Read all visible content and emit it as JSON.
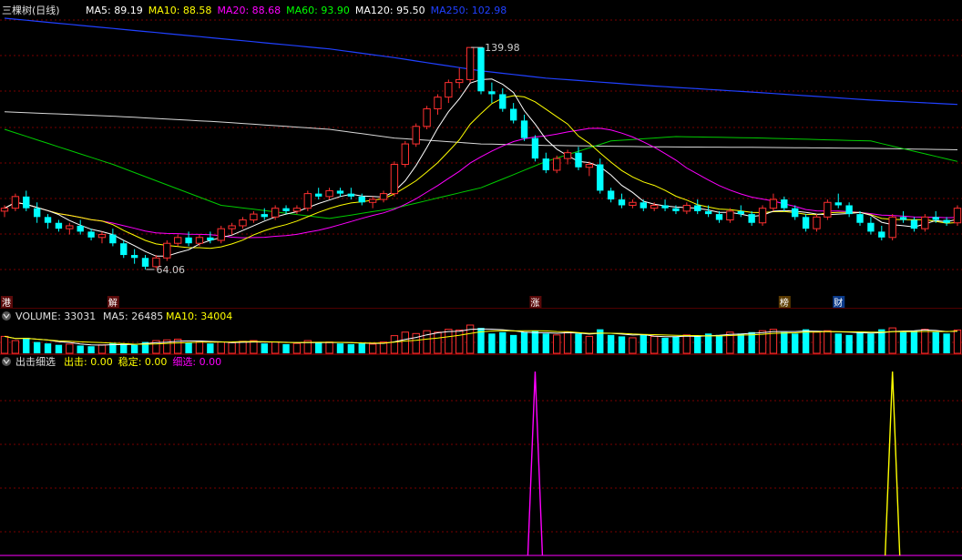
{
  "stock_title": "三棵树(日线)",
  "main_legend": [
    {
      "label": "MA5: 89.19",
      "color": "#ffffff"
    },
    {
      "label": "MA10: 88.58",
      "color": "#ffff00"
    },
    {
      "label": "MA20: 88.68",
      "color": "#ff00ff"
    },
    {
      "label": "MA60: 93.90",
      "color": "#00ff00"
    },
    {
      "label": "MA120: 95.50",
      "color": "#ffffff"
    },
    {
      "label": "MA250: 102.98",
      "color": "#2040ff"
    }
  ],
  "max_label": "139.98",
  "min_label": "64.06",
  "event_tags": [
    "港",
    "解",
    "涨",
    "榜",
    "财"
  ],
  "volume_panel": {
    "title": "VOLUME: 33031",
    "ma5": "MA5: 26485",
    "ma10": "MA10: 34004"
  },
  "indicator_panel": {
    "name": "出击细选",
    "fields": [
      {
        "label": "出击: 0.00",
        "color": "#ffff00"
      },
      {
        "label": "稳定: 0.00",
        "color": "#ffff00"
      },
      {
        "label": "细选: 0.00",
        "color": "#ff00ff"
      }
    ]
  },
  "colors": {
    "up": "#ff3030",
    "down": "#00ffff",
    "grid": "#7a0000",
    "border": "#a00000"
  },
  "chart_data": {
    "type": "line",
    "title": "",
    "ylim": [
      55,
      150
    ],
    "candles": [
      [
        84,
        86,
        82,
        85
      ],
      [
        85,
        90,
        84,
        89
      ],
      [
        89,
        91,
        84,
        85
      ],
      [
        85,
        87,
        80,
        82
      ],
      [
        82,
        83,
        78,
        80
      ],
      [
        80,
        81,
        77,
        78
      ],
      [
        78,
        80,
        76,
        79
      ],
      [
        79,
        81,
        76,
        77
      ],
      [
        77,
        78,
        74,
        75
      ],
      [
        75,
        77,
        73,
        76
      ],
      [
        76,
        78,
        72,
        73
      ],
      [
        73,
        74,
        68,
        69
      ],
      [
        69,
        71,
        66,
        68
      ],
      [
        68,
        69,
        64.06,
        65
      ],
      [
        65,
        69,
        64.5,
        68
      ],
      [
        68,
        74,
        67,
        73
      ],
      [
        73,
        76,
        72,
        75
      ],
      [
        75,
        77,
        72,
        73
      ],
      [
        73,
        76,
        72,
        75
      ],
      [
        75,
        77,
        73,
        74
      ],
      [
        74,
        79,
        73,
        78
      ],
      [
        78,
        80,
        76,
        79
      ],
      [
        79,
        82,
        78,
        81
      ],
      [
        81,
        84,
        80,
        83
      ],
      [
        83,
        85,
        81,
        82
      ],
      [
        82,
        86,
        81,
        85
      ],
      [
        85,
        86,
        83,
        84
      ],
      [
        84,
        86,
        83,
        85
      ],
      [
        85,
        91,
        84,
        90
      ],
      [
        90,
        92,
        88,
        89
      ],
      [
        89,
        92,
        88,
        91
      ],
      [
        91,
        92,
        89,
        90
      ],
      [
        90,
        92,
        88,
        89
      ],
      [
        89,
        90,
        86,
        87
      ],
      [
        87,
        89,
        85,
        88
      ],
      [
        88,
        91,
        87,
        90
      ],
      [
        90,
        101,
        89,
        100
      ],
      [
        100,
        108,
        99,
        107
      ],
      [
        107,
        114,
        106,
        113
      ],
      [
        113,
        120,
        112,
        119
      ],
      [
        119,
        124,
        117,
        123
      ],
      [
        123,
        129,
        121,
        128
      ],
      [
        128,
        133,
        126,
        129
      ],
      [
        129,
        140,
        128,
        139.98
      ],
      [
        139.98,
        139.98,
        124,
        125
      ],
      [
        125,
        128,
        121,
        124
      ],
      [
        124,
        126,
        118,
        119
      ],
      [
        119,
        121,
        114,
        115
      ],
      [
        115,
        117,
        108,
        109
      ],
      [
        109,
        110,
        101,
        102
      ],
      [
        102,
        104,
        97,
        98
      ],
      [
        98,
        103,
        97,
        102
      ],
      [
        102,
        105,
        100,
        104
      ],
      [
        104,
        106,
        98,
        99
      ],
      [
        99,
        101,
        96,
        100
      ],
      [
        100,
        102,
        90,
        91
      ],
      [
        91,
        92,
        87,
        88
      ],
      [
        88,
        90,
        85,
        86
      ],
      [
        86,
        88,
        85,
        87
      ],
      [
        87,
        88,
        84,
        85
      ],
      [
        85,
        87,
        84,
        86
      ],
      [
        86,
        88,
        84,
        85
      ],
      [
        85,
        86,
        83,
        84
      ],
      [
        84,
        87,
        83,
        86
      ],
      [
        86,
        88,
        83,
        84
      ],
      [
        84,
        86,
        82,
        83
      ],
      [
        83,
        84,
        80,
        81
      ],
      [
        81,
        85,
        80,
        84
      ],
      [
        84,
        86,
        82,
        83
      ],
      [
        83,
        84,
        79,
        80
      ],
      [
        80,
        86,
        79,
        85
      ],
      [
        85,
        90,
        84,
        88
      ],
      [
        88,
        89,
        84,
        85
      ],
      [
        85,
        86,
        81,
        82
      ],
      [
        82,
        83,
        77,
        78
      ],
      [
        78,
        83,
        77,
        82
      ],
      [
        82,
        88,
        81,
        87
      ],
      [
        87,
        90,
        85,
        86
      ],
      [
        86,
        87,
        82,
        83
      ],
      [
        83,
        84,
        79,
        80
      ],
      [
        80,
        82,
        76,
        77
      ],
      [
        77,
        79,
        74,
        75
      ],
      [
        75,
        83,
        74,
        82
      ],
      [
        82,
        84,
        80,
        81
      ],
      [
        81,
        82,
        77,
        78
      ],
      [
        78,
        83,
        77,
        82
      ],
      [
        82,
        84,
        80,
        81
      ],
      [
        81,
        82,
        79,
        80
      ],
      [
        80,
        86,
        79,
        85
      ]
    ],
    "tag_indices": [
      0,
      10,
      49,
      72,
      77
    ],
    "ma250": [
      [
        0,
        150.0
      ],
      [
        10,
        146.5
      ],
      [
        20,
        143.0
      ],
      [
        30,
        139.5
      ],
      [
        36,
        136.5
      ],
      [
        44,
        132.0
      ],
      [
        50,
        129.5
      ],
      [
        60,
        126.8
      ],
      [
        70,
        124.5
      ],
      [
        80,
        122.0
      ],
      [
        88,
        120.5
      ]
    ],
    "ma120": [
      [
        0,
        118.0
      ],
      [
        10,
        116.5
      ],
      [
        20,
        114.5
      ],
      [
        30,
        112.0
      ],
      [
        36,
        109.0
      ],
      [
        44,
        107.0
      ],
      [
        50,
        106.5
      ],
      [
        60,
        106.0
      ],
      [
        70,
        105.8
      ],
      [
        80,
        105.5
      ],
      [
        88,
        105.0
      ]
    ],
    "ma60": [
      [
        0,
        112.0
      ],
      [
        10,
        100.0
      ],
      [
        20,
        86.0
      ],
      [
        30,
        81.5
      ],
      [
        36,
        85.0
      ],
      [
        44,
        92.0
      ],
      [
        50,
        101.0
      ],
      [
        56,
        108.0
      ],
      [
        62,
        109.5
      ],
      [
        70,
        109.0
      ],
      [
        80,
        108.0
      ],
      [
        88,
        101.0
      ]
    ],
    "volume": [
      [
        24000,
        1
      ],
      [
        18000,
        1
      ],
      [
        22000,
        0
      ],
      [
        16000,
        0
      ],
      [
        14000,
        0
      ],
      [
        12000,
        0
      ],
      [
        13000,
        1
      ],
      [
        11000,
        0
      ],
      [
        10000,
        0
      ],
      [
        12000,
        1
      ],
      [
        15000,
        0
      ],
      [
        14000,
        0
      ],
      [
        12000,
        0
      ],
      [
        16000,
        0
      ],
      [
        18000,
        1
      ],
      [
        19000,
        1
      ],
      [
        20000,
        1
      ],
      [
        15000,
        0
      ],
      [
        16000,
        1
      ],
      [
        14000,
        0
      ],
      [
        16000,
        1
      ],
      [
        15000,
        1
      ],
      [
        17000,
        1
      ],
      [
        18000,
        1
      ],
      [
        14000,
        0
      ],
      [
        16000,
        1
      ],
      [
        13000,
        0
      ],
      [
        14000,
        1
      ],
      [
        18000,
        1
      ],
      [
        15000,
        0
      ],
      [
        16000,
        1
      ],
      [
        14000,
        0
      ],
      [
        13000,
        0
      ],
      [
        14000,
        0
      ],
      [
        13000,
        1
      ],
      [
        16000,
        1
      ],
      [
        25000,
        1
      ],
      [
        30000,
        1
      ],
      [
        28000,
        1
      ],
      [
        32000,
        1
      ],
      [
        30000,
        1
      ],
      [
        34000,
        1
      ],
      [
        33000,
        1
      ],
      [
        40000,
        1
      ],
      [
        36000,
        0
      ],
      [
        28000,
        0
      ],
      [
        30000,
        0
      ],
      [
        26000,
        0
      ],
      [
        30000,
        0
      ],
      [
        32000,
        0
      ],
      [
        28000,
        0
      ],
      [
        26000,
        1
      ],
      [
        30000,
        1
      ],
      [
        28000,
        0
      ],
      [
        24000,
        1
      ],
      [
        34000,
        0
      ],
      [
        26000,
        0
      ],
      [
        24000,
        0
      ],
      [
        22000,
        1
      ],
      [
        26000,
        0
      ],
      [
        24000,
        1
      ],
      [
        22000,
        0
      ],
      [
        24000,
        0
      ],
      [
        26000,
        1
      ],
      [
        24000,
        0
      ],
      [
        28000,
        0
      ],
      [
        26000,
        0
      ],
      [
        30000,
        1
      ],
      [
        28000,
        0
      ],
      [
        30000,
        0
      ],
      [
        32000,
        1
      ],
      [
        34000,
        1
      ],
      [
        30000,
        0
      ],
      [
        28000,
        0
      ],
      [
        34000,
        0
      ],
      [
        30000,
        1
      ],
      [
        32000,
        1
      ],
      [
        28000,
        0
      ],
      [
        26000,
        0
      ],
      [
        30000,
        0
      ],
      [
        28000,
        0
      ],
      [
        34000,
        0
      ],
      [
        36000,
        1
      ],
      [
        30000,
        0
      ],
      [
        32000,
        0
      ],
      [
        34000,
        1
      ],
      [
        30000,
        0
      ],
      [
        28000,
        0
      ],
      [
        33031,
        1
      ]
    ],
    "signal_spikes": [
      {
        "index": 49,
        "color": "#ff00ff"
      },
      {
        "index": 82,
        "color": "#ffff00"
      }
    ]
  }
}
